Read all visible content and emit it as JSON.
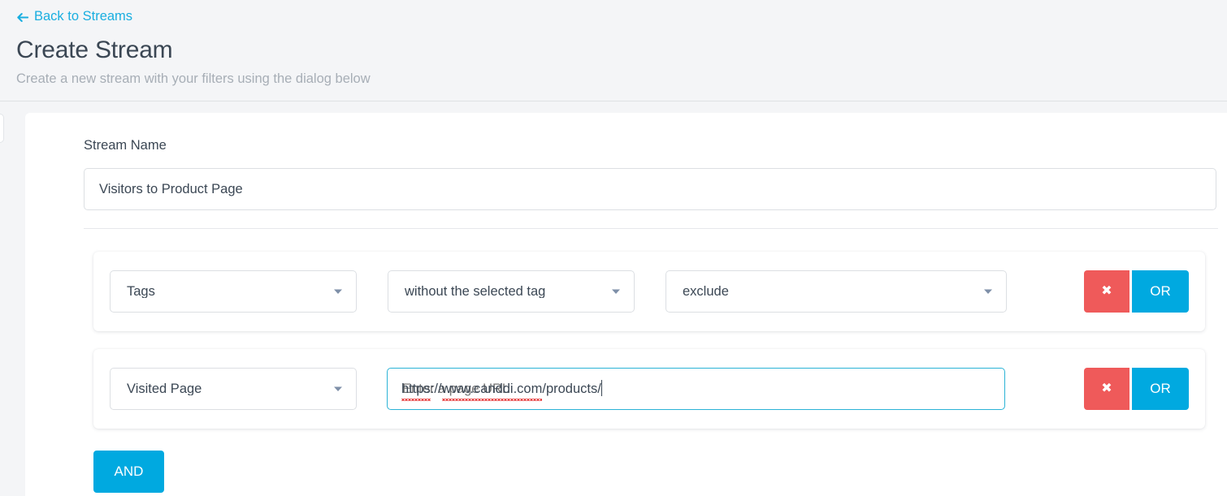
{
  "header": {
    "back_link": "Back to Streams",
    "back_icon": "arrow-left-icon",
    "title": "Create Stream",
    "subtitle": "Create a new stream with your filters using the dialog below"
  },
  "form": {
    "stream_name_label": "Stream Name",
    "stream_name_value": "Visitors to Product Page",
    "stream_name_placeholder": "Stream Name"
  },
  "filters": [
    {
      "field": "Tags",
      "condition": "without the selected tag",
      "value": "exclude",
      "value_type": "select",
      "remove_label": "✖",
      "or_label": "OR"
    },
    {
      "field": "Visited Page",
      "value_type": "text",
      "url_parts": {
        "scheme": "https",
        "separator": "://",
        "host": "www.canddi.com",
        "path": "/products/"
      },
      "value": "https://www.canddi.com/products/",
      "placeholder": "Enter a page URL",
      "remove_label": "✖",
      "or_label": "OR"
    }
  ],
  "actions": {
    "and_label": "AND"
  },
  "colors": {
    "accent_blue": "#00a9e0",
    "link_blue": "#19aee0",
    "danger_red": "#ef5a5a",
    "focus_border": "#2bb3d6",
    "page_background": "#f4f5f7",
    "text_dark": "#3b4754",
    "text_muted": "#a7aeb6",
    "chevron": "#7e8fa8"
  }
}
